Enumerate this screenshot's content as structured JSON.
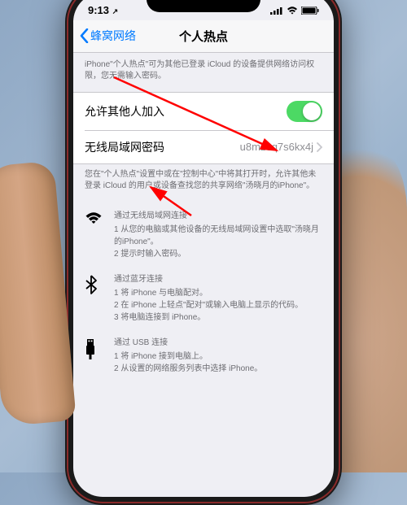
{
  "status": {
    "time": "9:13",
    "time_suffix": "↗"
  },
  "nav": {
    "back": "蜂窝网络",
    "title": "个人热点"
  },
  "header_desc": "iPhone\"个人热点\"可为其他已登录 iCloud 的设备提供网络访问权限，您无需输入密码。",
  "rows": {
    "allow": {
      "label": "允许其他人加入",
      "on": true
    },
    "password": {
      "label": "无线局域网密码",
      "value": "u8mzeq7s6kx4j"
    }
  },
  "footer_desc": "您在\"个人热点\"设置中或在\"控制中心\"中将其打开时，允许其他未登录 iCloud 的用户或设备查找您的共享网络\"汤晓月的iPhone\"。",
  "methods": {
    "wifi": {
      "title": "通过无线局域网连接",
      "l1": "1 从您的电脑或其他设备的无线局域网设置中选取\"汤晓月的iPhone\"。",
      "l2": "2 提示时输入密码。"
    },
    "bt": {
      "title": "通过蓝牙连接",
      "l1": "1 将 iPhone 与电脑配对。",
      "l2": "2 在 iPhone 上轻点\"配对\"或输入电脑上显示的代码。",
      "l3": "3 将电脑连接到 iPhone。"
    },
    "usb": {
      "title": "通过 USB 连接",
      "l1": "1 将 iPhone 接到电脑上。",
      "l2": "2 从设置的网络服务列表中选择 iPhone。"
    }
  }
}
